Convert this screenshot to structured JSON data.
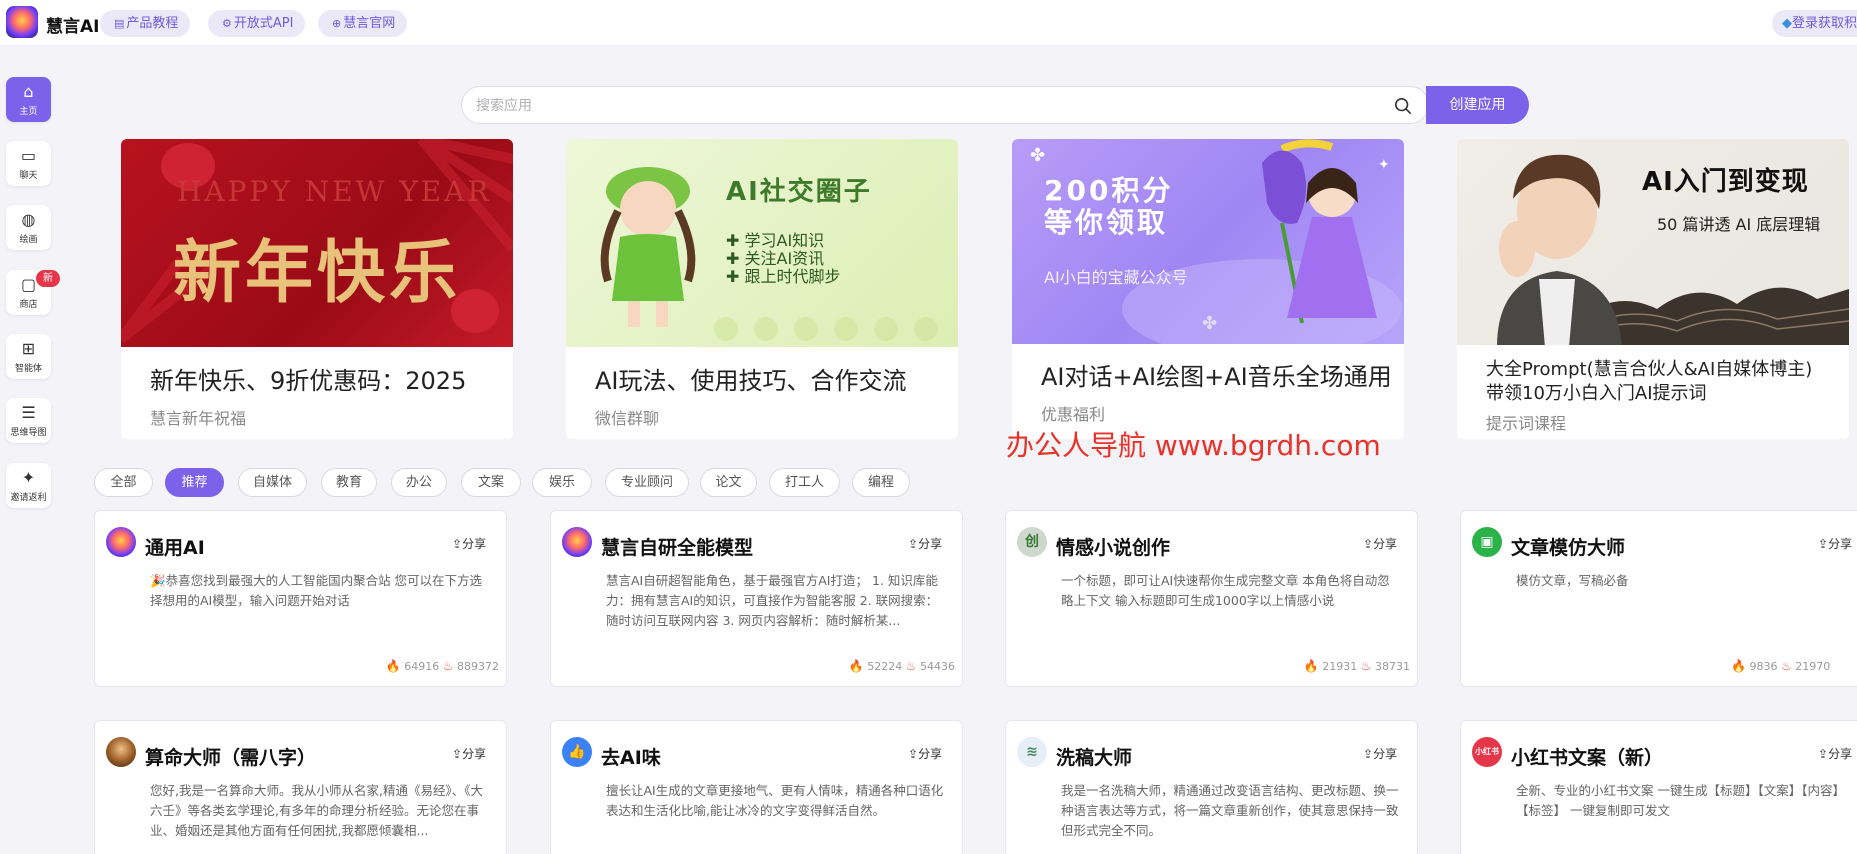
{
  "header": {
    "brand": "慧言AI",
    "nav": [
      {
        "label": "产品教程"
      },
      {
        "label": "开放式API"
      },
      {
        "label": "慧言官网"
      }
    ],
    "login": "登录获取积分"
  },
  "sidebar": {
    "items": [
      {
        "label": "主页",
        "icon": "home-icon"
      },
      {
        "label": "聊天",
        "icon": "chat-icon"
      },
      {
        "label": "绘画",
        "icon": "palette-icon"
      },
      {
        "label": "商店",
        "icon": "shop-bag-icon"
      },
      {
        "label": "智能体",
        "icon": "agent-grid-icon"
      },
      {
        "label": "思维导图",
        "icon": "mindmap-icon"
      },
      {
        "label": "邀请返利",
        "icon": "gift-icon"
      }
    ],
    "new_badge": "新"
  },
  "search": {
    "placeholder": "搜索应用",
    "create_label": "创建应用"
  },
  "banners": [
    {
      "title": "新年快乐、9折优惠码：2025",
      "subtitle": "慧言新年祝福",
      "img_en": "HAPPY NEW YEAR",
      "img_cn": "新年快乐"
    },
    {
      "title": "AI玩法、使用技巧、合作交流",
      "subtitle": "微信群聊",
      "img_title": "AI社交圈子",
      "img_list": [
        "学习AI知识",
        "关注AI资讯",
        "跟上时代脚步"
      ]
    },
    {
      "title": "AI对话+AI绘图+AI音乐全场通用",
      "subtitle": "优惠福利",
      "img_big1": "200积分",
      "img_big2": "等你领取",
      "img_small": "AI小白的宝藏公众号"
    },
    {
      "title1": "大全Prompt(慧言合伙人&AI自媒体博主)",
      "title2": "带领10万小白入门AI提示词",
      "subtitle": "提示词课程",
      "img_big": "AI入门到变现",
      "img_small": "50 篇讲透 AI 底层理辑"
    }
  ],
  "watermark": "办公人导航 www.bgrdh.com",
  "filters": [
    {
      "label": "全部"
    },
    {
      "label": "推荐",
      "active": true
    },
    {
      "label": "自媒体"
    },
    {
      "label": "教育"
    },
    {
      "label": "办公"
    },
    {
      "label": "文案"
    },
    {
      "label": "娱乐"
    },
    {
      "label": "专业顾问"
    },
    {
      "label": "论文"
    },
    {
      "label": "打工人"
    },
    {
      "label": "编程"
    }
  ],
  "share_label": "分享",
  "cards": [
    {
      "title": "通用AI",
      "desc": "🎉恭喜您找到最强大的人工智能国内聚合站 您可以在下方选择想用的AI模型，输入问题开始对话",
      "hot": "64916",
      "uses": "889372",
      "icon_color": "#1b1b2b",
      "icon_text": ""
    },
    {
      "title": "慧言自研全能模型",
      "desc": "慧言AI自研超智能角色，基于最强官方AI打造； 1. 知识库能力：拥有慧言AI的知识，可直接作为智能客服 2. 联网搜索：随时访问互联网内容 3. 网页内容解析：随时解析某...",
      "hot": "52224",
      "uses": "54436",
      "icon_color": "#1b1b2b",
      "icon_text": ""
    },
    {
      "title": "情感小说创作",
      "desc": "一个标题，即可让AI快速帮你生成完整文章 本角色将自动忽略上下文 输入标题即可生成1000字以上情感小说",
      "hot": "21931",
      "uses": "38731",
      "icon_color": "#cfd8cc",
      "icon_text": "创"
    },
    {
      "title": "文章模仿大师",
      "desc": "模仿文章，写稿必备",
      "hot": "9836",
      "uses": "21970",
      "icon_color": "#2bb34a",
      "icon_text": "▣"
    },
    {
      "title": "算命大师（需八字）",
      "desc": "您好,我是一名算命大师。我从小师从名家,精通《易经》、《大六壬》等各类玄学理论,有多年的命理分析经验。无论您在事业、婚姻还是其他方面有任何困扰,我都愿倾囊相...",
      "icon_color": "#6b3a10",
      "icon_text": ""
    },
    {
      "title": "去AI味",
      "desc": "擅长让AI生成的文章更接地气、更有人情味，精通各种口语化表达和生活化比喻,能让冰冷的文字变得鲜活自然。",
      "icon_color": "#3b82f6",
      "icon_text": "👍"
    },
    {
      "title": "洗稿大师",
      "desc": "我是一名洗稿大师，精通通过改变语言结构、更改标题、换一种语言表达等方式，将一篇文章重新创作，使其意思保持一致但形式完全不同。",
      "icon_color": "#e6eef7",
      "icon_text": "≋"
    },
    {
      "title": "小红书文案（新）",
      "desc": "全新、专业的小红书文案 一键生成【标题】【文案】【内容】【标签】 一键复制即可发文",
      "icon_color": "#e5374a",
      "icon_text": "小红书"
    }
  ]
}
